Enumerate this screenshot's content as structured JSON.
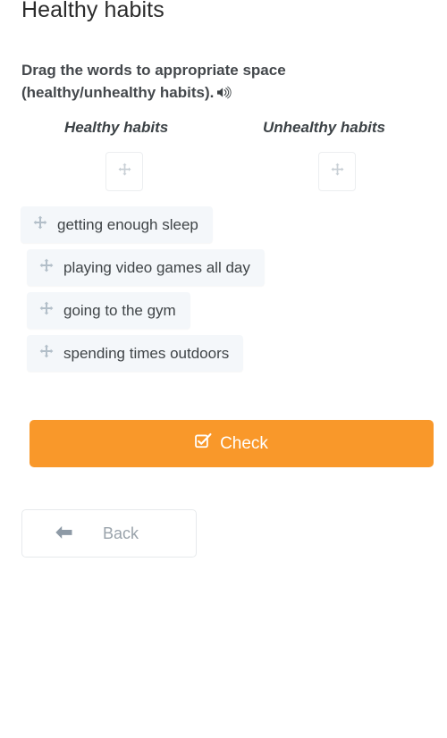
{
  "page_title": "Healthy habits",
  "instruction": {
    "text": "Drag the words to appropriate space (healthy/unhealthy habits).",
    "audio_icon": "speaker-icon"
  },
  "columns": [
    {
      "id": "healthy",
      "label": "Healthy habits",
      "dropzone_icon": "move-icon",
      "dropped_words": []
    },
    {
      "id": "unhealthy",
      "label": "Unhealthy habits",
      "dropzone_icon": "move-icon",
      "dropped_words": []
    }
  ],
  "draggable_words": [
    {
      "label": "getting enough sleep",
      "icon": "move-icon"
    },
    {
      "label": "playing video games all day",
      "icon": "move-icon"
    },
    {
      "label": "going to the gym",
      "icon": "move-icon"
    },
    {
      "label": "spending times outdoors",
      "icon": "move-icon"
    }
  ],
  "buttons": {
    "check": {
      "label": "Check",
      "icon": "checkbox-checked-icon",
      "color": "#f9982a",
      "text_color": "#ffffff"
    },
    "back": {
      "label": "Back",
      "icon": "arrow-left-icon",
      "color": "#ffffff",
      "text_color": "#9aa3ab"
    }
  },
  "colors": {
    "background": "#ffffff",
    "chip_background": "#f4f7fa",
    "accent": "#f9982a",
    "text_dark": "#3f4447",
    "text_muted": "#9aa3ab",
    "icon_gray": "#b4bcc4"
  }
}
